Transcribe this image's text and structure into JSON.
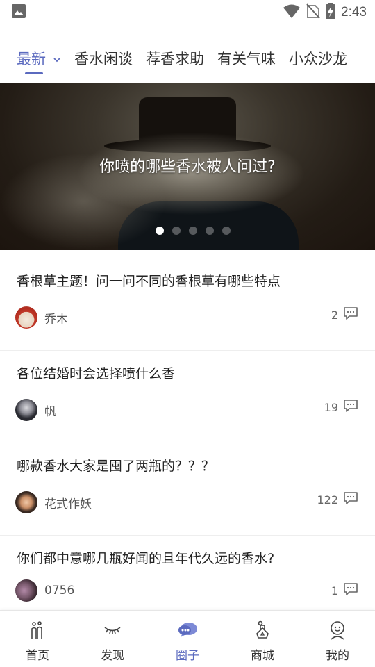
{
  "status_bar": {
    "time": "2:43"
  },
  "tabs": [
    {
      "label": "最新",
      "active": true
    },
    {
      "label": "香水闲谈",
      "active": false
    },
    {
      "label": "荐香求助",
      "active": false
    },
    {
      "label": "有关气味",
      "active": false
    },
    {
      "label": "小众沙龙",
      "active": false
    }
  ],
  "banner": {
    "title": "你喷的哪些香水被人问过?",
    "total_slides": 5,
    "active_slide": 1
  },
  "posts": [
    {
      "title": "香根草主题！问一问不同的香根草有哪些特点",
      "author": "乔木",
      "comments": "2"
    },
    {
      "title": "各位结婚时会选择喷什么香",
      "author": "帆",
      "comments": "19"
    },
    {
      "title": "哪款香水大家是囤了两瓶的？？？",
      "author": "花式作妖",
      "comments": "122"
    },
    {
      "title": "你们都中意哪几瓶好闻的且年代久远的香水?",
      "author": "0756",
      "comments": "1"
    }
  ],
  "bottom_nav": [
    {
      "label": "首页",
      "icon": "home-icon",
      "active": false
    },
    {
      "label": "发现",
      "icon": "eyelash-icon",
      "active": false
    },
    {
      "label": "圈子",
      "icon": "chat-bubbles-icon",
      "active": true
    },
    {
      "label": "商城",
      "icon": "perfume-bottle-icon",
      "active": false
    },
    {
      "label": "我的",
      "icon": "user-icon",
      "active": false
    }
  ],
  "colors": {
    "accent": "#5b6abf",
    "text": "#222222",
    "muted": "#666666"
  }
}
